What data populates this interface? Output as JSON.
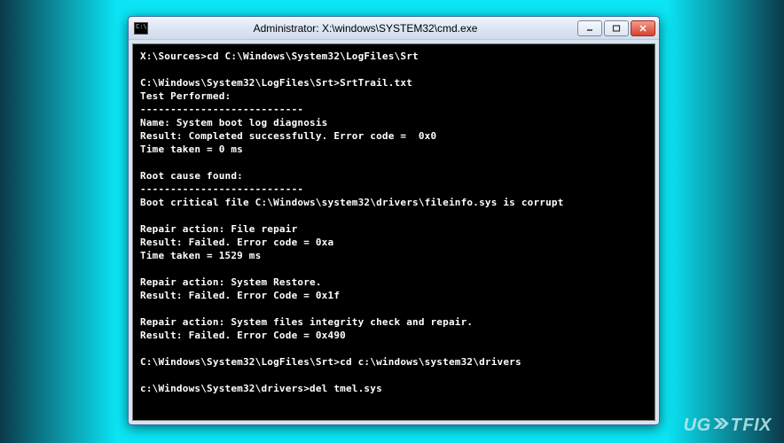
{
  "window": {
    "title": "Administrator: X:\\windows\\SYSTEM32\\cmd.exe",
    "icon_label": "C:\\"
  },
  "terminal": {
    "lines": [
      "X:\\Sources>cd C:\\Windows\\System32\\LogFiles\\Srt",
      "",
      "C:\\Windows\\System32\\LogFiles\\Srt>SrtTrail.txt",
      "Test Performed:",
      "---------------------------",
      "Name: System boot log diagnosis",
      "Result: Completed successfully. Error code =  0x0",
      "Time taken = 0 ms",
      "",
      "Root cause found:",
      "---------------------------",
      "Boot critical file C:\\Windows\\system32\\drivers\\fileinfo.sys is corrupt",
      "",
      "Repair action: File repair",
      "Result: Failed. Error code = 0xa",
      "Time taken = 1529 ms",
      "",
      "Repair action: System Restore.",
      "Result: Failed. Error Code = 0x1f",
      "",
      "Repair action: System files integrity check and repair.",
      "Result: Failed. Error Code = 0x490",
      "",
      "C:\\Windows\\System32\\LogFiles\\Srt>cd c:\\windows\\system32\\drivers",
      "",
      "c:\\Windows\\System32\\drivers>del tmel.sys"
    ]
  },
  "watermark": {
    "pre": "UG",
    "mid": "T",
    "post": "FIX"
  },
  "colors": {
    "bg_cyan": "#0be5f5",
    "window_chrome": "#dce6f4",
    "close_red": "#d9402d"
  }
}
